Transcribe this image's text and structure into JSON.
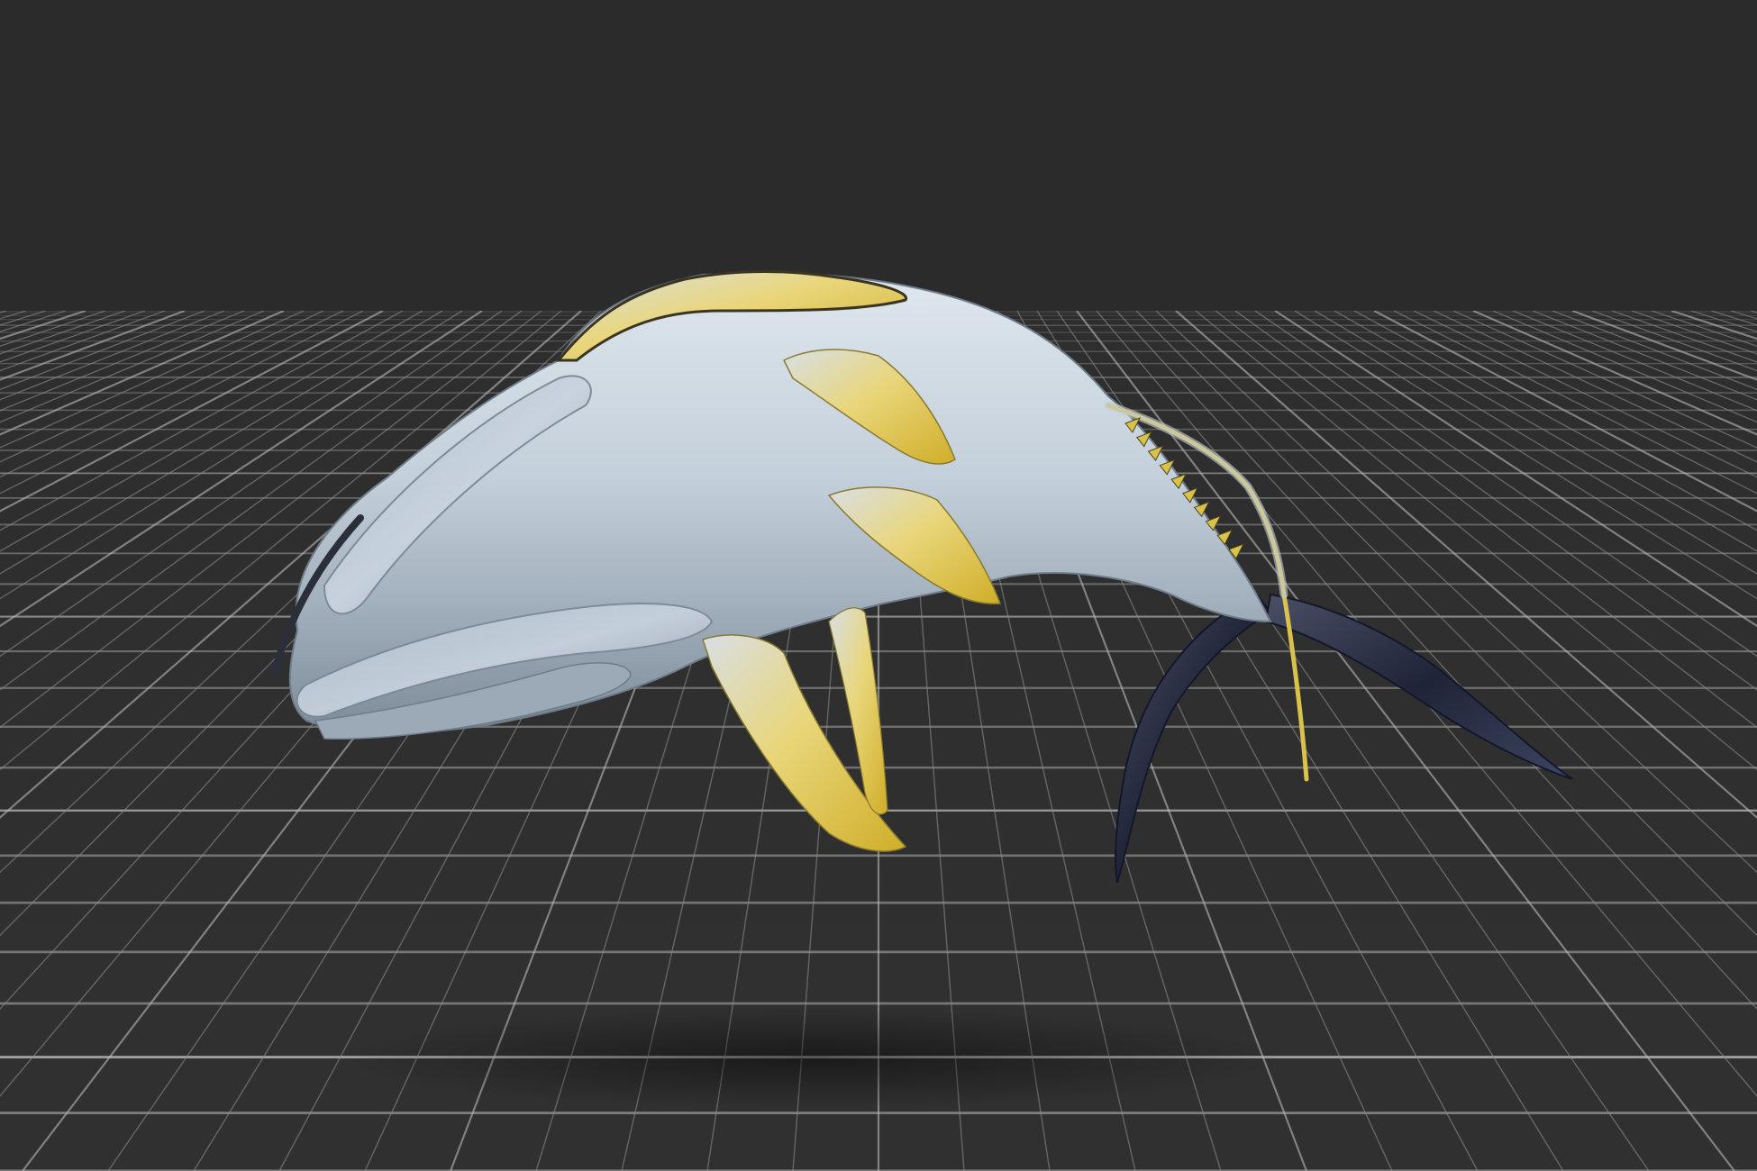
{
  "viewport": {
    "background_color": "#2b2b2b",
    "grid_color": "#8a8a8a",
    "grid_major_color": "#b8b8b8"
  },
  "model": {
    "kind": "whale",
    "body_color": "#c9d3dc",
    "fin_color": "#e2c94a",
    "tail_color": "#2a2f44"
  }
}
